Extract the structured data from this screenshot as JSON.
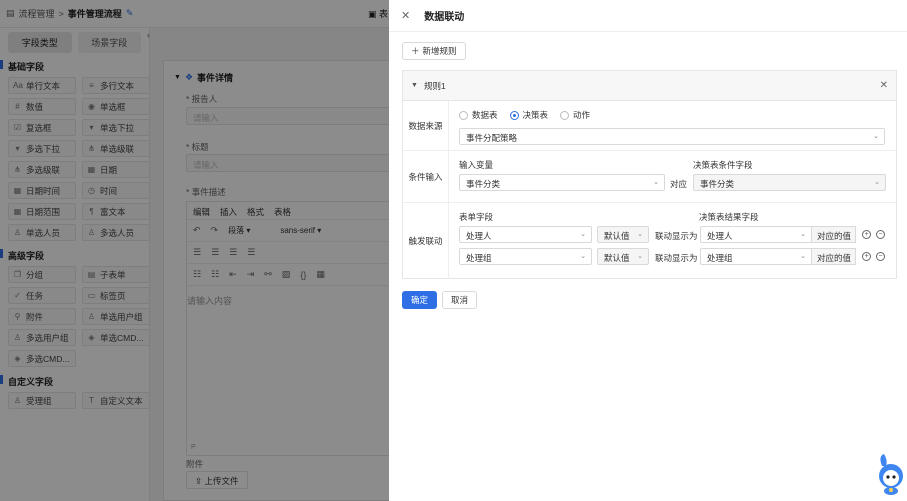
{
  "topbar": {
    "crumbs": [
      "流程管理",
      "事件管理流程"
    ],
    "separator": ">",
    "right_tab": "表"
  },
  "left_panel": {
    "tabs": [
      "字段类型",
      "场景字段"
    ],
    "groups": [
      {
        "title": "基础字段",
        "items": [
          {
            "label": "单行文本",
            "icon": "text-line-icon"
          },
          {
            "label": "多行文本",
            "icon": "text-multiline-icon"
          },
          {
            "label": "数值",
            "icon": "number-icon"
          },
          {
            "label": "单选框",
            "icon": "radio-icon"
          },
          {
            "label": "复选框",
            "icon": "checkbox-icon"
          },
          {
            "label": "单选下拉",
            "icon": "dropdown-icon"
          },
          {
            "label": "多选下拉",
            "icon": "multi-dropdown-icon"
          },
          {
            "label": "单选级联",
            "icon": "cascade-icon"
          },
          {
            "label": "多选级联",
            "icon": "multi-cascade-icon"
          },
          {
            "label": "日期",
            "icon": "date-icon"
          },
          {
            "label": "日期时间",
            "icon": "datetime-icon"
          },
          {
            "label": "时间",
            "icon": "clock-icon"
          },
          {
            "label": "日期范围",
            "icon": "date-range-icon"
          },
          {
            "label": "富文本",
            "icon": "rich-text-icon"
          },
          {
            "label": "单选人员",
            "icon": "person-icon"
          },
          {
            "label": "多选人员",
            "icon": "people-icon"
          }
        ]
      },
      {
        "title": "高级字段",
        "items": [
          {
            "label": "分组",
            "icon": "group-icon"
          },
          {
            "label": "子表单",
            "icon": "subform-icon"
          },
          {
            "label": "任务",
            "icon": "task-icon"
          },
          {
            "label": "标签页",
            "icon": "tabs-icon"
          },
          {
            "label": "附件",
            "icon": "attachment-icon"
          },
          {
            "label": "单选用户组",
            "icon": "user-group-icon"
          },
          {
            "label": "多选用户组",
            "icon": "multi-user-group-icon"
          },
          {
            "label": "单选CMD...",
            "icon": "cmdb-icon"
          },
          {
            "label": "多选CMD...",
            "icon": "multi-cmdb-icon"
          }
        ]
      },
      {
        "title": "自定义字段",
        "items": [
          {
            "label": "受理组",
            "icon": "team-icon"
          },
          {
            "label": "自定义文本",
            "icon": "custom-text-icon"
          }
        ]
      }
    ]
  },
  "canvas": {
    "section_title": "事件详情",
    "fields": [
      {
        "label": "* 报告人",
        "placeholder": "请输入"
      },
      {
        "label": "* 标题",
        "placeholder": "请输入"
      }
    ],
    "editor": {
      "label": "* 事件描述",
      "menu": [
        "编辑",
        "插入",
        "格式",
        "表格"
      ],
      "block_format": "段落",
      "font_family": "sans-serif",
      "placeholder": "请输入内容",
      "status": "P"
    },
    "attach_label": "附件",
    "upload_label": "上传文件"
  },
  "drawer": {
    "title": "数据联动",
    "add_rule": "新增规则",
    "rule": {
      "title": "规则1",
      "source": {
        "label": "数据来源",
        "options": [
          "数据表",
          "决策表",
          "动作"
        ],
        "selected": "决策表",
        "value": "事件分配策略"
      },
      "condition": {
        "label": "条件输入",
        "input_var_header": "输入变量",
        "decision_field_header": "决策表条件字段",
        "input_value": "事件分类",
        "relation": "对应",
        "decision_value": "事件分类"
      },
      "trigger": {
        "label": "触发联动",
        "form_field_header": "表单字段",
        "result_field_header": "决策表结果字段",
        "rows": [
          {
            "field": "处理人",
            "mode": "默认值",
            "display_as": "联动显示为",
            "result": "处理人",
            "addon": "对应的值"
          },
          {
            "field": "处理组",
            "mode": "默认值",
            "display_as": "联动显示为",
            "result": "处理组",
            "addon": "对应的值"
          }
        ]
      }
    },
    "confirm": "确定",
    "cancel": "取消"
  },
  "colors": {
    "primary": "#2e6fe6",
    "overlay": "rgba(0,0,0,0.45)"
  }
}
